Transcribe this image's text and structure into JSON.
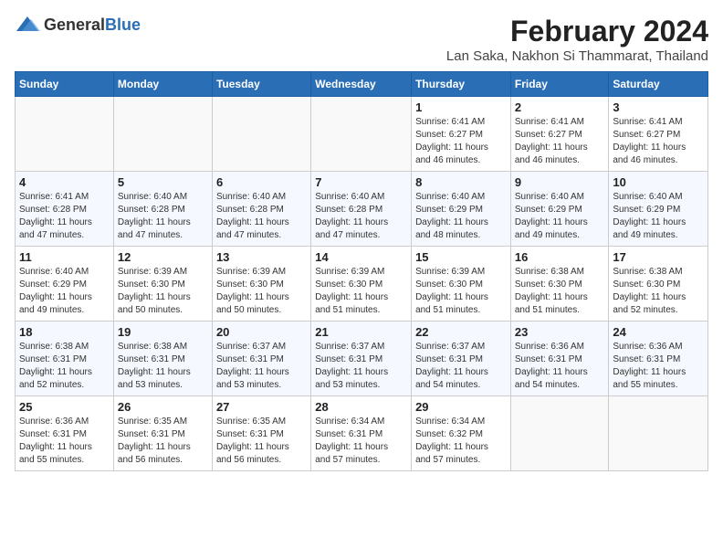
{
  "header": {
    "logo_general": "General",
    "logo_blue": "Blue",
    "title": "February 2024",
    "subtitle": "Lan Saka, Nakhon Si Thammarat, Thailand"
  },
  "columns": [
    "Sunday",
    "Monday",
    "Tuesday",
    "Wednesday",
    "Thursday",
    "Friday",
    "Saturday"
  ],
  "weeks": [
    [
      {
        "day": "",
        "info": ""
      },
      {
        "day": "",
        "info": ""
      },
      {
        "day": "",
        "info": ""
      },
      {
        "day": "",
        "info": ""
      },
      {
        "day": "1",
        "info": "Sunrise: 6:41 AM\nSunset: 6:27 PM\nDaylight: 11 hours\nand 46 minutes."
      },
      {
        "day": "2",
        "info": "Sunrise: 6:41 AM\nSunset: 6:27 PM\nDaylight: 11 hours\nand 46 minutes."
      },
      {
        "day": "3",
        "info": "Sunrise: 6:41 AM\nSunset: 6:27 PM\nDaylight: 11 hours\nand 46 minutes."
      }
    ],
    [
      {
        "day": "4",
        "info": "Sunrise: 6:41 AM\nSunset: 6:28 PM\nDaylight: 11 hours\nand 47 minutes."
      },
      {
        "day": "5",
        "info": "Sunrise: 6:40 AM\nSunset: 6:28 PM\nDaylight: 11 hours\nand 47 minutes."
      },
      {
        "day": "6",
        "info": "Sunrise: 6:40 AM\nSunset: 6:28 PM\nDaylight: 11 hours\nand 47 minutes."
      },
      {
        "day": "7",
        "info": "Sunrise: 6:40 AM\nSunset: 6:28 PM\nDaylight: 11 hours\nand 47 minutes."
      },
      {
        "day": "8",
        "info": "Sunrise: 6:40 AM\nSunset: 6:29 PM\nDaylight: 11 hours\nand 48 minutes."
      },
      {
        "day": "9",
        "info": "Sunrise: 6:40 AM\nSunset: 6:29 PM\nDaylight: 11 hours\nand 49 minutes."
      },
      {
        "day": "10",
        "info": "Sunrise: 6:40 AM\nSunset: 6:29 PM\nDaylight: 11 hours\nand 49 minutes."
      }
    ],
    [
      {
        "day": "11",
        "info": "Sunrise: 6:40 AM\nSunset: 6:29 PM\nDaylight: 11 hours\nand 49 minutes."
      },
      {
        "day": "12",
        "info": "Sunrise: 6:39 AM\nSunset: 6:30 PM\nDaylight: 11 hours\nand 50 minutes."
      },
      {
        "day": "13",
        "info": "Sunrise: 6:39 AM\nSunset: 6:30 PM\nDaylight: 11 hours\nand 50 minutes."
      },
      {
        "day": "14",
        "info": "Sunrise: 6:39 AM\nSunset: 6:30 PM\nDaylight: 11 hours\nand 51 minutes."
      },
      {
        "day": "15",
        "info": "Sunrise: 6:39 AM\nSunset: 6:30 PM\nDaylight: 11 hours\nand 51 minutes."
      },
      {
        "day": "16",
        "info": "Sunrise: 6:38 AM\nSunset: 6:30 PM\nDaylight: 11 hours\nand 51 minutes."
      },
      {
        "day": "17",
        "info": "Sunrise: 6:38 AM\nSunset: 6:30 PM\nDaylight: 11 hours\nand 52 minutes."
      }
    ],
    [
      {
        "day": "18",
        "info": "Sunrise: 6:38 AM\nSunset: 6:31 PM\nDaylight: 11 hours\nand 52 minutes."
      },
      {
        "day": "19",
        "info": "Sunrise: 6:38 AM\nSunset: 6:31 PM\nDaylight: 11 hours\nand 53 minutes."
      },
      {
        "day": "20",
        "info": "Sunrise: 6:37 AM\nSunset: 6:31 PM\nDaylight: 11 hours\nand 53 minutes."
      },
      {
        "day": "21",
        "info": "Sunrise: 6:37 AM\nSunset: 6:31 PM\nDaylight: 11 hours\nand 53 minutes."
      },
      {
        "day": "22",
        "info": "Sunrise: 6:37 AM\nSunset: 6:31 PM\nDaylight: 11 hours\nand 54 minutes."
      },
      {
        "day": "23",
        "info": "Sunrise: 6:36 AM\nSunset: 6:31 PM\nDaylight: 11 hours\nand 54 minutes."
      },
      {
        "day": "24",
        "info": "Sunrise: 6:36 AM\nSunset: 6:31 PM\nDaylight: 11 hours\nand 55 minutes."
      }
    ],
    [
      {
        "day": "25",
        "info": "Sunrise: 6:36 AM\nSunset: 6:31 PM\nDaylight: 11 hours\nand 55 minutes."
      },
      {
        "day": "26",
        "info": "Sunrise: 6:35 AM\nSunset: 6:31 PM\nDaylight: 11 hours\nand 56 minutes."
      },
      {
        "day": "27",
        "info": "Sunrise: 6:35 AM\nSunset: 6:31 PM\nDaylight: 11 hours\nand 56 minutes."
      },
      {
        "day": "28",
        "info": "Sunrise: 6:34 AM\nSunset: 6:31 PM\nDaylight: 11 hours\nand 57 minutes."
      },
      {
        "day": "29",
        "info": "Sunrise: 6:34 AM\nSunset: 6:32 PM\nDaylight: 11 hours\nand 57 minutes."
      },
      {
        "day": "",
        "info": ""
      },
      {
        "day": "",
        "info": ""
      }
    ]
  ]
}
